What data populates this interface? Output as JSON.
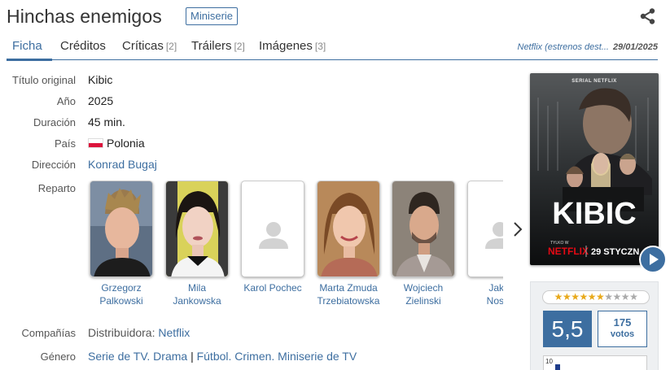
{
  "header": {
    "title": "Hinchas enemigos",
    "badge": "Miniserie"
  },
  "tabs": [
    {
      "label": "Ficha",
      "count": ""
    },
    {
      "label": "Créditos",
      "count": ""
    },
    {
      "label": "Críticas",
      "count": "[2]"
    },
    {
      "label": "Tráilers",
      "count": "[2]"
    },
    {
      "label": "Imágenes",
      "count": "[3]"
    }
  ],
  "release": {
    "platform": "Netflix (estrenos dest...",
    "date": "29/01/2025"
  },
  "details": {
    "titulo_original_label": "Título original",
    "titulo_original": "Kibic",
    "anio_label": "Año",
    "anio": "2025",
    "duracion_label": "Duración",
    "duracion": "45 min.",
    "pais_label": "País",
    "pais": "Polonia",
    "direccion_label": "Dirección",
    "direccion": "Konrad Bugaj",
    "reparto_label": "Reparto",
    "companias_label": "Compañías",
    "companias_prefix": "Distribuidora:",
    "companias_value": "Netflix",
    "genero_label": "Género",
    "genero_1": "Serie de TV. Drama",
    "genero_sep": "|",
    "genero_2": "Fútbol. Crimen. Miniserie de TV"
  },
  "cast": [
    {
      "line1": "Grzegorz",
      "line2": "Palkowski",
      "photo": true
    },
    {
      "line1": "Mila",
      "line2": "Jankowska",
      "photo": true
    },
    {
      "line1": "Karol Pochec",
      "line2": "",
      "photo": false
    },
    {
      "line1": "Marta Zmuda",
      "line2": "Trzebiatowska",
      "photo": true
    },
    {
      "line1": "Wojciech",
      "line2": "Zielinski",
      "photo": true
    },
    {
      "line1": "Jaku",
      "line2": "Nosia",
      "photo": false
    }
  ],
  "poster": {
    "top_text": "SERIAL NETFLIX",
    "title": "KIBIC",
    "tylko": "TYLKO W",
    "brand": "NETFLIX",
    "date": "29 STYCZN"
  },
  "rating": {
    "stars_filled": 5.5,
    "stars_total": 10,
    "score": "5,5",
    "votes_count": "175",
    "votes_label": "votos",
    "histogram_top": "10"
  },
  "colors": {
    "accent": "#3d6ea0",
    "star": "#e8a91b",
    "netflix_red": "#e50914"
  }
}
